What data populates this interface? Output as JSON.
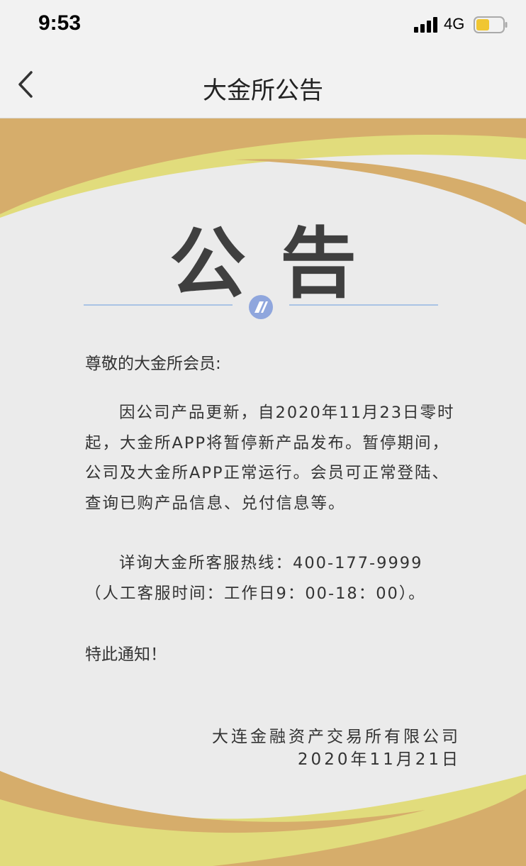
{
  "status_bar": {
    "time": "9:53",
    "network": "4G"
  },
  "nav": {
    "title": "大金所公告",
    "back_icon": "chevron-left-icon"
  },
  "notice": {
    "heading": "公告",
    "greeting": "尊敬的大金所会员:",
    "body": "因公司产品更新，自2020年11月23日零时起，大金所APP将暂停新产品发布。暂停期间，公司及大金所APP正常运行。会员可正常登陆、查询已购产品信息、兑付信息等。",
    "hotline_line1": "详询大金所客服热线：400-177-9999",
    "hotline_line2": "（人工客服时间：工作日9：00-18：00）。",
    "closing": "特此通知！",
    "signature_company": "大连金融资产交易所有限公司",
    "signature_date": "2020年11月21日"
  },
  "colors": {
    "gold": "#d6ad6b",
    "yellow": "#e1dc7c",
    "divider": "#a9c3e4",
    "emblem": "#8fa6dd"
  }
}
